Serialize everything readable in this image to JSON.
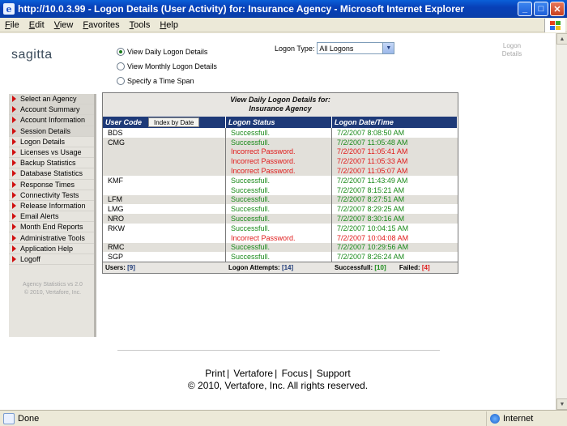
{
  "window": {
    "title": "http://10.0.3.99 - Logon Details (User Activity) for: Insurance Agency - Microsoft Internet Explorer"
  },
  "menu": [
    "File",
    "Edit",
    "View",
    "Favorites",
    "Tools",
    "Help"
  ],
  "page": {
    "logo": "sagitta",
    "radios": [
      {
        "label": "View Daily Logon Details",
        "checked": true
      },
      {
        "label": "View Monthly Logon Details",
        "checked": false
      },
      {
        "label": "Specify a Time Span",
        "checked": false
      }
    ],
    "logon_type_label": "Logon Type:",
    "logon_type_value": "All Logons",
    "logon_details_link": "Logon Details"
  },
  "sidebar": {
    "items": [
      "Select an Agency",
      "Account Summary",
      "Account Information",
      "Session Details",
      "Logon Details",
      "Licenses vs Usage",
      "Backup Statistics",
      "Database Statistics",
      "Response Times",
      "Connectivity Tests",
      "Release Information",
      "Email Alerts",
      "Month End Reports",
      "Administrative Tools",
      "Application Help",
      "Logoff"
    ],
    "footer_line1": "Agency Statistics vs 2.0",
    "footer_line2": "© 2010,  Vertafore, Inc."
  },
  "report": {
    "title_line1": "View Daily Logon Details for:",
    "title_line2": "Insurance Agency",
    "headers": {
      "user": "User Code",
      "status": "Logon Status",
      "datetime": "Logon Date/Time"
    },
    "index_button": "Index by Date",
    "rows": [
      {
        "user": "BDS",
        "status": "Successfull.",
        "time": "7/2/2007 8:08:50 AM",
        "ok": true,
        "alt": false
      },
      {
        "user": "CMG",
        "status": "Successfull.",
        "time": "7/2/2007 11:05:48 AM",
        "ok": true,
        "alt": true
      },
      {
        "user": "",
        "status": "Incorrect Password.",
        "time": "7/2/2007 11:05:41 AM",
        "ok": false,
        "alt": true
      },
      {
        "user": "",
        "status": "Incorrect Password.",
        "time": "7/2/2007 11:05:33 AM",
        "ok": false,
        "alt": true
      },
      {
        "user": "",
        "status": "Incorrect Password.",
        "time": "7/2/2007 11:05:07 AM",
        "ok": false,
        "alt": true
      },
      {
        "user": "KMF",
        "status": "Successfull.",
        "time": "7/2/2007 11:43:49 AM",
        "ok": true,
        "alt": false
      },
      {
        "user": "",
        "status": "Successfull.",
        "time": "7/2/2007 8:15:21 AM",
        "ok": true,
        "alt": false
      },
      {
        "user": "LFM",
        "status": "Successfull.",
        "time": "7/2/2007 8:27:51 AM",
        "ok": true,
        "alt": true
      },
      {
        "user": "LMG",
        "status": "Successfull.",
        "time": "7/2/2007 8:29:25 AM",
        "ok": true,
        "alt": false
      },
      {
        "user": "NRO",
        "status": "Successfull.",
        "time": "7/2/2007 8:30:16 AM",
        "ok": true,
        "alt": true
      },
      {
        "user": "RKW",
        "status": "Successfull.",
        "time": "7/2/2007 10:04:15 AM",
        "ok": true,
        "alt": false
      },
      {
        "user": "",
        "status": "Incorrect Password.",
        "time": "7/2/2007 10:04:08 AM",
        "ok": false,
        "alt": false
      },
      {
        "user": "RMC",
        "status": "Successfull.",
        "time": "7/2/2007 10:29:56 AM",
        "ok": true,
        "alt": true
      },
      {
        "user": "SGP",
        "status": "Successfull.",
        "time": "7/2/2007 8:26:24 AM",
        "ok": true,
        "alt": false
      }
    ],
    "footer": {
      "users_label": "Users:",
      "users_value": "[9]",
      "attempts_label": "Logon Attempts:",
      "attempts_value": "[14]",
      "success_label": "Successfull:",
      "success_value": "[10]",
      "failed_label": "Failed:",
      "failed_value": "[4]"
    }
  },
  "footer": {
    "links": [
      "Print",
      "Vertafore",
      "Focus",
      "Support"
    ],
    "copyright": "© 2010,  Vertafore, Inc. All rights reserved."
  },
  "status": {
    "text": "Done",
    "zone": "Internet"
  }
}
